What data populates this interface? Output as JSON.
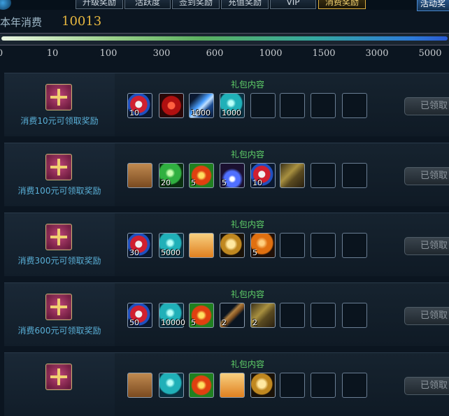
{
  "tabs": [
    {
      "label": "升级奖励",
      "active": false
    },
    {
      "label": "活跃度",
      "active": false
    },
    {
      "label": "签到奖励",
      "active": false
    },
    {
      "label": "充值奖励",
      "active": false
    },
    {
      "label": "VIP",
      "active": false
    },
    {
      "label": "消费奖励",
      "active": true
    }
  ],
  "right_button": {
    "label": "活动奖"
  },
  "annual": {
    "label": "本年消费",
    "value": "10013"
  },
  "progress": {
    "value": 10013,
    "ticks": [
      "0",
      "10",
      "100",
      "300",
      "600",
      "1000",
      "1500",
      "3000",
      "5000"
    ]
  },
  "content_title": "礼包内容",
  "claim_label": "已领取",
  "tiers": [
    {
      "label": "消费10元可领取奖励",
      "items": [
        {
          "icon": "red-scroll-icon",
          "qty": "10"
        },
        {
          "icon": "red-gem-icon",
          "qty": ""
        },
        {
          "icon": "blue-crystal-icon",
          "qty": "1000"
        },
        {
          "icon": "teal-orb-icon",
          "qty": "1000"
        }
      ]
    },
    {
      "label": "消费100元可领取奖励",
      "items": [
        {
          "icon": "wooden-box-icon",
          "qty": ""
        },
        {
          "icon": "green-orb-icon",
          "qty": "20"
        },
        {
          "icon": "fire-orb-icon",
          "qty": "5"
        },
        {
          "icon": "blue-potion-icon",
          "qty": "5"
        },
        {
          "icon": "red-scroll-icon",
          "qty": "10"
        },
        {
          "icon": "book-icon",
          "qty": ""
        }
      ]
    },
    {
      "label": "消费300元可领取奖励",
      "items": [
        {
          "icon": "red-scroll-icon",
          "qty": "30"
        },
        {
          "icon": "teal-orb-icon",
          "qty": "5000"
        },
        {
          "icon": "gift-box-icon",
          "qty": ""
        },
        {
          "icon": "golden-pouch-icon",
          "qty": ""
        },
        {
          "icon": "amber-orb-icon",
          "qty": "5"
        }
      ]
    },
    {
      "label": "消费600元可领取奖励",
      "items": [
        {
          "icon": "red-scroll-icon",
          "qty": "50"
        },
        {
          "icon": "teal-orb-icon",
          "qty": "10000"
        },
        {
          "icon": "fire-orb-icon",
          "qty": "5"
        },
        {
          "icon": "staff-icon",
          "qty": "2"
        },
        {
          "icon": "book-icon",
          "qty": "2"
        }
      ]
    },
    {
      "label": "",
      "items": [
        {
          "icon": "wooden-box-icon",
          "qty": ""
        },
        {
          "icon": "teal-orb-icon",
          "qty": ""
        },
        {
          "icon": "fire-orb-icon",
          "qty": ""
        },
        {
          "icon": "gift-box-icon",
          "qty": ""
        },
        {
          "icon": "golden-pouch-icon",
          "qty": ""
        }
      ]
    }
  ]
}
